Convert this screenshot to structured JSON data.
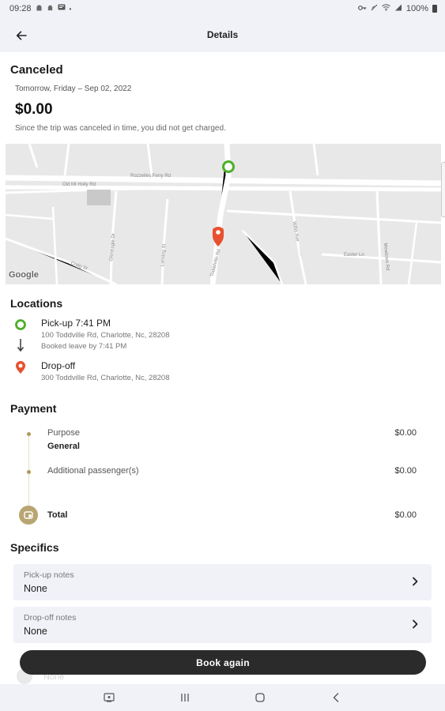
{
  "status_bar": {
    "time": "09:28",
    "battery": "100%",
    "icons": [
      "android-icon",
      "android-icon",
      "message-icon",
      "dot-icon",
      "key-icon",
      "mute-icon",
      "wifi-icon",
      "signal-icon",
      "battery-icon"
    ]
  },
  "app_bar": {
    "title": "Details",
    "back_icon": "arrow-left-icon"
  },
  "trip": {
    "status": "Canceled",
    "date": "Tomorrow, Friday – Sep 02, 2022",
    "amount": "$0.00",
    "note": "Since the trip was canceled in time, you did not get charged."
  },
  "map": {
    "streets": [
      "Rozzelles Ferry Rd",
      "Old Mt Holly Rd",
      "Todddville Rd",
      "Gleneagle Dr",
      "Lansing St",
      "Craig St",
      "Willis Ave",
      "Easter Ln",
      "Meadows Rd"
    ],
    "attribution": "Google",
    "pickup_marker_color": "#4caf28",
    "dropoff_marker_color": "#e8502f"
  },
  "locations": {
    "heading": "Locations",
    "pickup": {
      "title": "Pick-up 7:41 PM",
      "address": "100 Toddville Rd, Charlotte, Nc, 28208",
      "booked": "Booked leave by 7:41 PM"
    },
    "dropoff": {
      "title": "Drop-off",
      "address": "300 Toddville Rd, Charlotte, Nc, 28208"
    }
  },
  "payment": {
    "heading": "Payment",
    "items": [
      {
        "label": "Purpose",
        "sub": "General",
        "amount": "$0.00"
      },
      {
        "label": "Additional passenger(s)",
        "amount": "$0.00"
      }
    ],
    "total_label": "Total",
    "total_amount": "$0.00",
    "accent_color": "#b19a55"
  },
  "specifics": {
    "heading": "Specifics",
    "pickup_notes": {
      "label": "Pick-up notes",
      "value": "None"
    },
    "dropoff_notes": {
      "label": "Drop-off notes",
      "value": "None"
    },
    "hidden_value": "None"
  },
  "actions": {
    "book_again": "Book again"
  },
  "nav_bar": {
    "icons": [
      "screenshot-icon",
      "recents-icon",
      "home-icon",
      "back-icon"
    ]
  }
}
